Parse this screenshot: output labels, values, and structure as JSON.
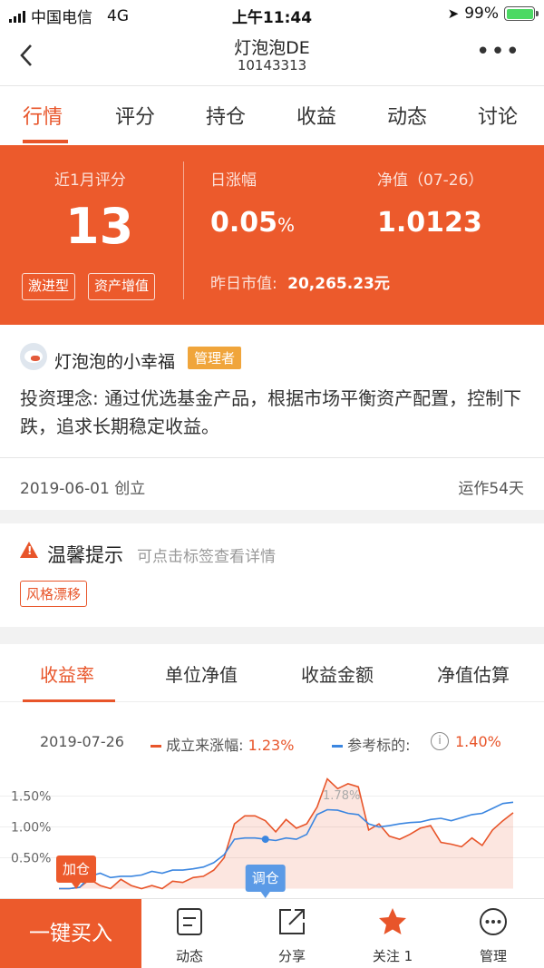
{
  "status_bar": {
    "carrier": "中国电信",
    "network": "4G",
    "time": "上午11:44",
    "battery": "99%"
  },
  "header": {
    "title": "灯泡泡DE",
    "code": "10143313"
  },
  "tabs": [
    "行情",
    "评分",
    "持仓",
    "收益",
    "动态",
    "讨论"
  ],
  "summary": {
    "score_label": "近1月评分",
    "score_value": "13",
    "tags": [
      "激进型",
      "资产增值"
    ],
    "daily_change_label": "日涨幅",
    "daily_change_value": "0.05",
    "daily_change_unit": "%",
    "nav_label": "净值（07-26）",
    "nav_value": "1.0123",
    "market_value_label": "昨日市值:",
    "market_value": "20,265.23元"
  },
  "manager": {
    "nickname": "灯泡泡的小幸福",
    "role": "管理者",
    "philosophy": "投资理念: 通过优选基金产品，根据市场平衡资产配置，控制下跌，追求长期稳定收益。"
  },
  "meta": {
    "founded": "2019-06-01 创立",
    "running": "运作54天"
  },
  "tip": {
    "title": "温馨提示",
    "hint": "可点击标签查看详情",
    "tag": "风格漂移"
  },
  "chart_tabs": [
    "收益率",
    "单位净值",
    "收益金额",
    "净值估算"
  ],
  "chart_legend": {
    "date": "2019-07-26",
    "series1_label": "成立来涨幅:",
    "series1_value": "1.23%",
    "series2_label": "参考标的:",
    "series2_value": "1.40%",
    "info_icon": "i"
  },
  "colors": {
    "accent": "#ec5a2c",
    "series1": "#e8552a",
    "series2": "#3b86e0",
    "role_badge": "#f0a53b"
  },
  "chart_data": {
    "type": "line",
    "y_ticks": [
      "1.50%",
      "1.00%",
      "0.50%"
    ],
    "series": [
      {
        "name": "成立来涨幅",
        "values": [
          0.0,
          0.0,
          0.02,
          0.15,
          0.05,
          0.0,
          0.15,
          0.05,
          0.0,
          0.05,
          0.0,
          0.12,
          0.1,
          0.18,
          0.2,
          0.3,
          0.5,
          1.05,
          1.18,
          1.18,
          1.1,
          0.92,
          1.12,
          0.98,
          1.05,
          1.32,
          1.78,
          1.62,
          1.7,
          1.65,
          0.95,
          1.05,
          0.85,
          0.8,
          0.88,
          0.98,
          1.02,
          0.75,
          0.72,
          0.68,
          0.82,
          0.7,
          0.95,
          1.1,
          1.23
        ]
      },
      {
        "name": "参考标的",
        "values": [
          0.0,
          0.0,
          0.02,
          0.2,
          0.25,
          0.18,
          0.2,
          0.2,
          0.22,
          0.28,
          0.25,
          0.3,
          0.3,
          0.32,
          0.35,
          0.42,
          0.55,
          0.8,
          0.82,
          0.82,
          0.8,
          0.78,
          0.82,
          0.8,
          0.88,
          1.2,
          1.28,
          1.27,
          1.22,
          1.2,
          1.05,
          1.0,
          1.02,
          1.05,
          1.07,
          1.08,
          1.12,
          1.14,
          1.1,
          1.15,
          1.2,
          1.22,
          1.3,
          1.38,
          1.4
        ]
      }
    ],
    "annotations": [
      "加仓",
      "调仓",
      "1.78%"
    ]
  },
  "bottom_bar": {
    "buy": "一键买入",
    "items": [
      "动态",
      "分享",
      "关注 1",
      "管理"
    ]
  }
}
